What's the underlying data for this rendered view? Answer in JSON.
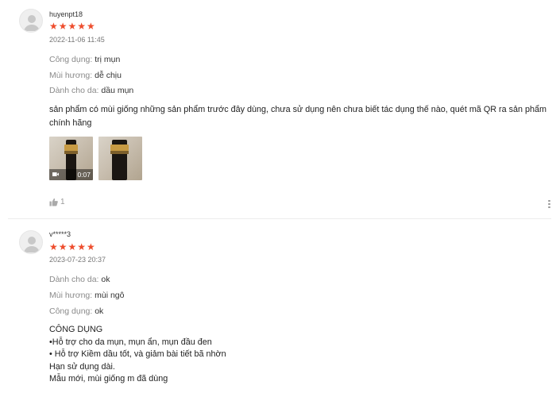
{
  "reviews": [
    {
      "username": "huyenpt18",
      "stars": "★★★★★",
      "datetime": "2022-11-06 11:45",
      "attributes": [
        {
          "label": "Công dụng:",
          "value": "trị mụn"
        },
        {
          "label": "Mùi hương:",
          "value": "dễ chịu"
        },
        {
          "label": "Dành cho da:",
          "value": "dầu mụn"
        }
      ],
      "text_lines": [
        "sản phẩm có mùi giống những sản phẩm trước đây dùng, chưa sử dụng nên chưa biết tác dụng thế nào, quét mã QR ra sản phẩm",
        "chính hãng"
      ],
      "video_duration": "0:07",
      "like_count": "1"
    },
    {
      "username": "v*****3",
      "stars": "★★★★★",
      "datetime": "2023-07-23 20:37",
      "attributes": [
        {
          "label": "Dành cho da:",
          "value": "ok"
        },
        {
          "label": "Mùi hương:",
          "value": "mùi ngô"
        },
        {
          "label": "Công dụng:",
          "value": "ok"
        }
      ],
      "text_lines": [
        "CÔNG DỤNG",
        "•Hỗ trợ cho da mụn, mụn ẩn, mụn đầu đen",
        "• Hỗ trợ Kiềm dầu tốt, và giảm bài tiết bã nhờn",
        "Hạn sử dụng dài.",
        "Mẫu mới, mùi giống m đã dùng"
      ]
    }
  ],
  "colors": {
    "star": "#ee4d2d",
    "label": "#8a8a8a",
    "divider": "#ececec"
  },
  "icons": [
    "user-avatar-icon",
    "star-icon",
    "video-icon",
    "thumbs-up-icon",
    "more-options-icon"
  ]
}
